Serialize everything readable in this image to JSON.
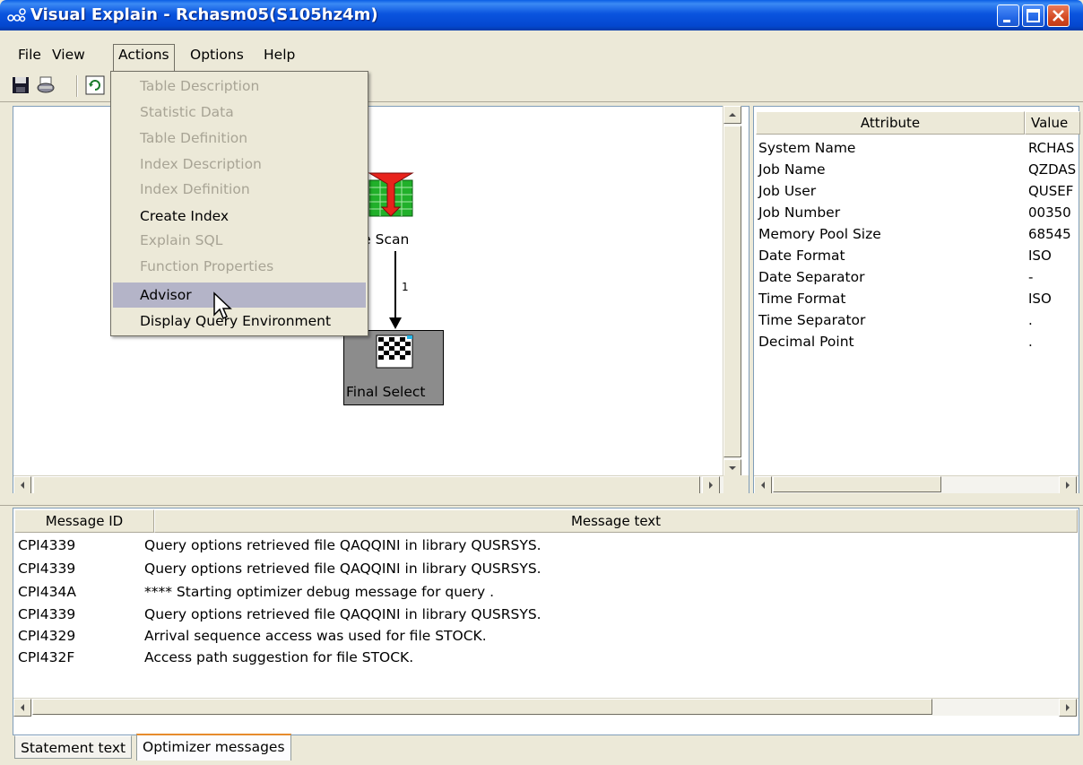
{
  "window": {
    "title": "Visual Explain - Rchasm05(S105hz4m)"
  },
  "menubar": {
    "file": "File",
    "view": "View",
    "actions": "Actions",
    "options": "Options",
    "help": "Help"
  },
  "actions_menu": {
    "items": [
      {
        "label": "Table Description",
        "enabled": false
      },
      {
        "label": "Statistic Data",
        "enabled": false
      },
      {
        "label": "Table Definition",
        "enabled": false
      },
      {
        "label": "Index Description",
        "enabled": false
      },
      {
        "label": "Index Definition",
        "enabled": false
      },
      {
        "label": "Create Index",
        "enabled": true
      },
      {
        "label": "Explain SQL",
        "enabled": false
      },
      {
        "label": "Function Properties",
        "enabled": false
      },
      {
        "label": "Advisor",
        "enabled": true,
        "highlighted": true
      },
      {
        "label": "Display Query Environment",
        "enabled": true
      }
    ]
  },
  "toolbar": {
    "icons": [
      "save-icon",
      "print-icon",
      "refresh-icon"
    ]
  },
  "graph": {
    "nodes": [
      {
        "label": "ble Scan",
        "icon": "table-scan-icon"
      },
      {
        "label": "Final Select",
        "icon": "final-select-icon"
      }
    ],
    "edge_label": "1"
  },
  "attributes": {
    "headers": {
      "name": "Attribute",
      "value": "Value"
    },
    "rows": [
      {
        "name": "System Name",
        "value": "RCHAS"
      },
      {
        "name": "Job Name",
        "value": "QZDAS"
      },
      {
        "name": "Job User",
        "value": "QUSEF"
      },
      {
        "name": "Job Number",
        "value": "00350"
      },
      {
        "name": "Memory Pool Size",
        "value": "68545"
      },
      {
        "name": "Date Format",
        "value": "ISO"
      },
      {
        "name": "Date Separator",
        "value": "-"
      },
      {
        "name": "Time Format",
        "value": "ISO"
      },
      {
        "name": "Time Separator",
        "value": "."
      },
      {
        "name": "Decimal Point",
        "value": "."
      }
    ]
  },
  "messages": {
    "headers": {
      "id": "Message ID",
      "text": "Message text"
    },
    "rows": [
      {
        "id": "CPI4339",
        "text": "Query options retrieved file QAQQINI in library QUSRSYS."
      },
      {
        "id": "CPI4339",
        "text": "Query options retrieved file QAQQINI in library QUSRSYS."
      },
      {
        "id": "CPI434A",
        "text": "**** Starting optimizer debug message for query ."
      },
      {
        "id": "CPI4339",
        "text": "Query options retrieved file QAQQINI in library QUSRSYS."
      },
      {
        "id": "CPI4329",
        "text": "Arrival sequence access was used for file STOCK."
      },
      {
        "id": "CPI432F",
        "text": "Access path suggestion for file STOCK."
      }
    ]
  },
  "tabs": [
    {
      "label": "Statement text",
      "active": false
    },
    {
      "label": "Optimizer messages",
      "active": true
    }
  ]
}
